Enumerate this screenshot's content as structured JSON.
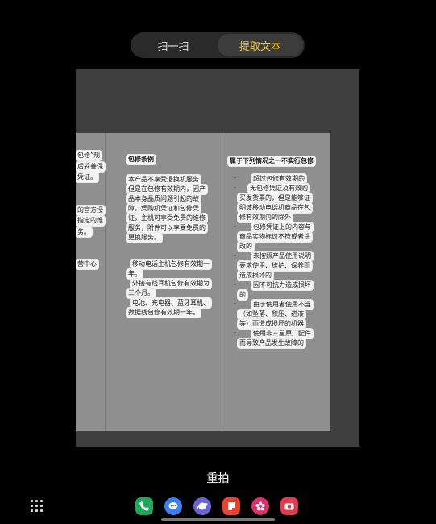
{
  "segmented": {
    "scan_label": "扫一扫",
    "extract_label": "提取文本",
    "active": "extract"
  },
  "document": {
    "left_column": [
      "包修”规",
      "后妥善保",
      "凭证。",
      "的官方授",
      "指定的维",
      "务。",
      "营中心"
    ],
    "middle_column": {
      "title": "包修条例",
      "para1": [
        "本产品不享受退换机服务",
        "但是在包修有效期内，因产",
        "品本身品质问题引起的故",
        "障，凭购机凭证和包修凭",
        "证，主机可享受免费的维修",
        "服务，附件可以享受免费的",
        "更换服务。"
      ],
      "para2": [
        "移动电话主机包修有效期一",
        "年。",
        "外接有线耳机包修有效期为",
        "三个月。",
        "电池、充电器、蓝牙耳机、",
        "数据线包修有效期一年。"
      ]
    },
    "right_column": {
      "title": "属于下列情况之一不实行包修",
      "lines": [
        "超过包修有效期的",
        "无包修凭证及有效购",
        "买发货票的，但是能够证",
        "明该移动电话机商品在包",
        "修有效期内的除外",
        "包修凭证上的内容与",
        "商品实物标识不符或者涂",
        "改的",
        "未按照产品使用说明",
        "要求使用、维护、保养而",
        "造成损坏的",
        "因不可抗力造成损坏",
        "的",
        "由于使用者使用不当",
        "（如坠落、积压、进液",
        "等）而造成损坏的机器",
        "使用非三星原厂配件",
        "而导致产品发生故障的"
      ]
    }
  },
  "retake_label": "重拍",
  "dock": {
    "apps": [
      {
        "name": "phone",
        "color": "#1faa59"
      },
      {
        "name": "messages",
        "color": "#3a7ff6"
      },
      {
        "name": "internet",
        "color": "#6b62d8"
      },
      {
        "name": "notes",
        "color": "#e8432f"
      },
      {
        "name": "flower-gallery",
        "color": "#e0306b"
      },
      {
        "name": "camera",
        "color": "#e23a4e"
      }
    ]
  }
}
